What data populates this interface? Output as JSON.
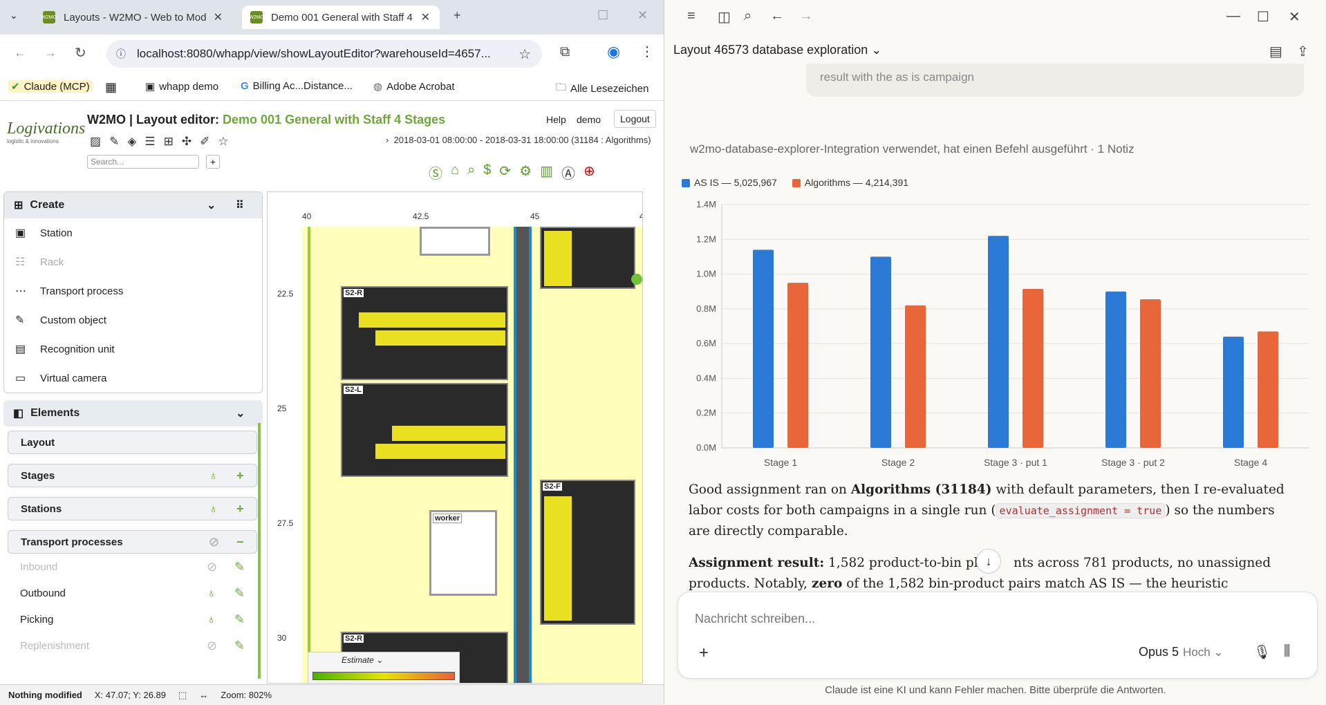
{
  "browser": {
    "tabs": [
      {
        "title": "Layouts - W2MO - Web to Mod",
        "favicon": "W2MO"
      },
      {
        "title": "Demo 001 General with Staff 4",
        "favicon": "W2MO"
      }
    ],
    "url": "localhost:8080/whapp/view/showLayoutEditor?warehouseId=4657...",
    "bookmarks": [
      "Claude (MCP)",
      "whapp demo",
      "Billing Ac...Distance...",
      "Adobe Acrobat",
      "Alle Lesezeichen"
    ]
  },
  "app": {
    "logo": "Logivations",
    "logo_sub": "logistic & innovations",
    "title_prefix": "W2MO | Layout editor: ",
    "title_layout": "Demo 001 General with Staff 4 Stages",
    "help": "Help",
    "user": "demo",
    "logout": "Logout",
    "date_range": "2018-03-01 08:00:00 - 2018-03-31 18:00:00 (31184 : Algorithms)",
    "search_placeholder": "Search..."
  },
  "create_panel": {
    "title": "Create",
    "items": [
      {
        "label": "Station",
        "disabled": false,
        "icon": "station-icon"
      },
      {
        "label": "Rack",
        "disabled": true,
        "icon": "rack-icon"
      },
      {
        "label": "Transport process",
        "disabled": false,
        "icon": "transport-icon"
      },
      {
        "label": "Custom object",
        "disabled": false,
        "icon": "custom-object-icon"
      },
      {
        "label": "Recognition unit",
        "disabled": false,
        "icon": "recognition-icon"
      },
      {
        "label": "Virtual camera",
        "disabled": false,
        "icon": "camera-icon"
      }
    ]
  },
  "elements_panel": {
    "title": "Elements",
    "layout": "Layout",
    "stages": "Stages",
    "stations": "Stations",
    "transport_processes": "Transport processes",
    "sub_items": [
      "Inbound",
      "Outbound",
      "Picking",
      "Replenishment"
    ]
  },
  "canvas": {
    "x_ticks": [
      "40",
      "42.5",
      "45",
      "4"
    ],
    "y_ticks": [
      "22.5",
      "25",
      "27.5",
      "30"
    ],
    "rack_labels": [
      "S2-R",
      "S2-L",
      "S2-F",
      "S2-R"
    ],
    "worker_label": "worker",
    "estimate": "Estimate"
  },
  "status": {
    "modified": "Nothing modified",
    "coords": "X: 47.07; Y: 26.89",
    "zoom": "Zoom: 802%"
  },
  "claude": {
    "conversation_title": "Layout 46573 database exploration",
    "user_snippet": "result with the as is campaign",
    "tool_line": "w2mo-database-explorer-Integration verwendet, hat einen Befehl ausgeführt · 1 Notiz",
    "para1_a": "Good assignment ran on ",
    "para1_b": "Algorithms (31184)",
    "para1_c": " with default parameters, then I re-evaluated labor costs for both campaigns in a single run (",
    "para1_code": "evaluate_assignment = true",
    "para1_d": ") so the numbers are directly comparable.",
    "para2_a": "Assignment result:",
    "para2_b": " 1,582 product-to-bin plac",
    "para2_c": "nts across 781 products, no unassigned products. Notably, ",
    "para2_d": "zero",
    "para2_e": " of the 1,582 bin-product pairs match AS IS — the heuristic",
    "composer_placeholder": "Nachricht schreiben...",
    "model": "Opus 5",
    "effort": "Hoch",
    "disclaimer": "Claude ist eine KI und kann Fehler machen. Bitte überprüfe die Antworten."
  },
  "chart_data": {
    "type": "bar",
    "categories": [
      "Stage 1",
      "Stage 2",
      "Stage 3 · put 1",
      "Stage 3 · put 2",
      "Stage 4"
    ],
    "series": [
      {
        "name": "AS IS — 5,025,967",
        "color": "#2b7bd6",
        "values": [
          1140000,
          1100000,
          1220000,
          900000,
          640000
        ]
      },
      {
        "name": "Algorithms — 4,214,391",
        "color": "#e8663a",
        "values": [
          950000,
          820000,
          915000,
          855000,
          670000
        ]
      }
    ],
    "y_ticks": [
      "0.0M",
      "0.2M",
      "0.4M",
      "0.6M",
      "0.8M",
      "1.0M",
      "1.2M",
      "1.4M"
    ],
    "ylim": [
      0,
      1400000
    ],
    "grid": true,
    "legend": "top-left"
  }
}
